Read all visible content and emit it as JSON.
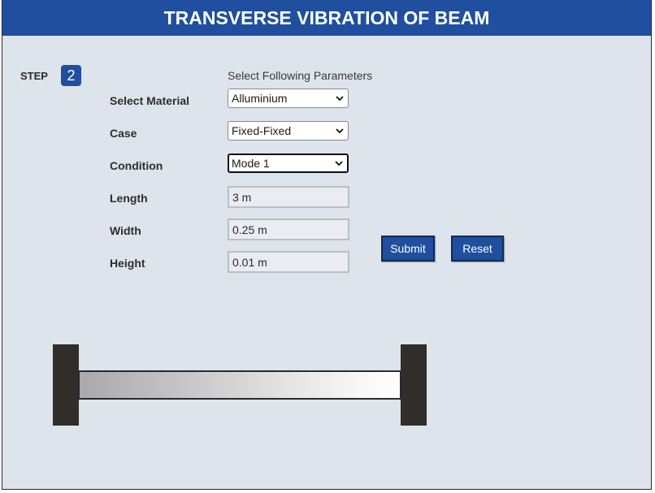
{
  "header": {
    "title": "TRANSVERSE VIBRATION OF BEAM"
  },
  "step": {
    "label": "STEP",
    "number": "2"
  },
  "form": {
    "instructions": "Select Following Parameters",
    "material": {
      "label": "Select Material",
      "value": "Alluminium"
    },
    "case": {
      "label": "Case",
      "value": "Fixed-Fixed"
    },
    "condition": {
      "label": "Condition",
      "value": "Mode 1"
    },
    "length": {
      "label": "Length",
      "value": "3 m"
    },
    "width": {
      "label": "Width",
      "value": "0.25 m"
    },
    "height": {
      "label": "Height",
      "value": "0.01 m"
    }
  },
  "buttons": {
    "submit": "Submit",
    "reset": "Reset"
  },
  "icons": {
    "dropdown": "chevron-down-icon"
  },
  "colors": {
    "header_bg": "#1f4f9e",
    "button_bg": "#1f4f9e",
    "panel_bg": "#dee4eb",
    "support": "#312d29"
  }
}
